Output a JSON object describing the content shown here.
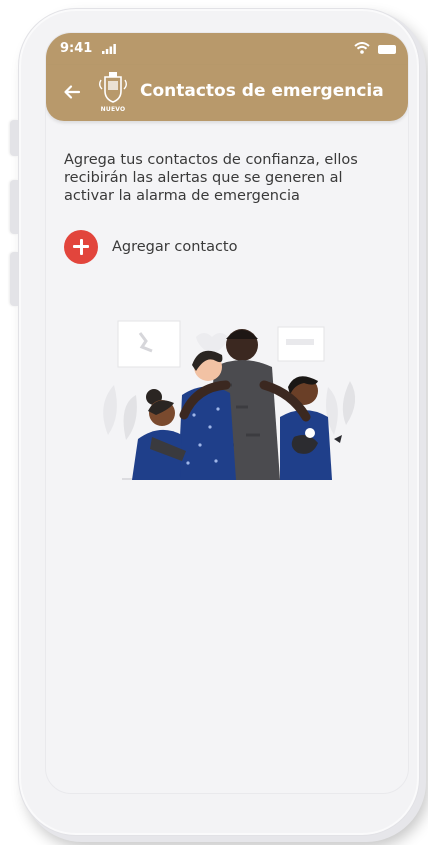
{
  "status_bar": {
    "time": "9:41"
  },
  "header": {
    "title": "Contactos de emergencia",
    "logo_text": "NUEVO"
  },
  "content": {
    "description": "Agrega tus contactos de confianza, ellos recibirán las alertas que se generen al activar la alarma de emergencia",
    "add_contact_label": "Agregar contacto"
  },
  "colors": {
    "header": "#b8996b",
    "add_button": "#e2453c",
    "background": "#f4f4f6"
  },
  "icons": {
    "back": "arrow-left-icon",
    "add": "plus-icon",
    "signal": "signal-icon",
    "wifi": "wifi-icon",
    "battery": "battery-icon"
  }
}
